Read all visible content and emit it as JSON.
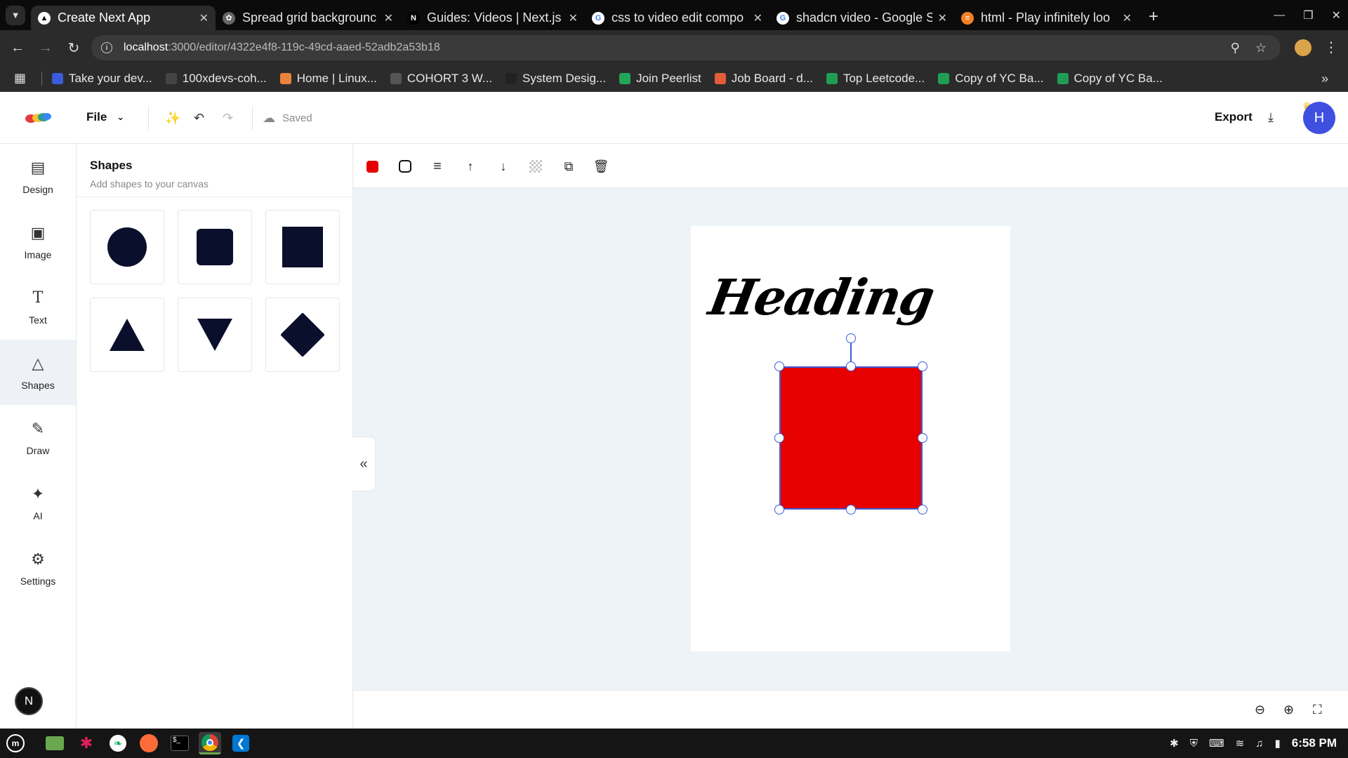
{
  "browser": {
    "tabs": [
      {
        "title": "Create Next App",
        "active": true
      },
      {
        "title": "Spread grid backgrounc",
        "active": false
      },
      {
        "title": "Guides: Videos | Next.js",
        "active": false
      },
      {
        "title": "css to video edit compo",
        "active": false
      },
      {
        "title": "shadcn video - Google S",
        "active": false
      },
      {
        "title": "html - Play infinitely loo",
        "active": false
      }
    ],
    "url_host": "localhost",
    "url_path": ":3000/editor/4322e4f8-119c-49cd-aaed-52adb2a53b18",
    "bookmarks": [
      {
        "label": "Take your dev...",
        "color": "#3b5bdb"
      },
      {
        "label": "100xdevs-coh...",
        "color": "#444444"
      },
      {
        "label": "Home | Linux...",
        "color": "#e8843c"
      },
      {
        "label": "COHORT 3 W...",
        "color": "#555555"
      },
      {
        "label": "System Desig...",
        "color": "#222222"
      },
      {
        "label": "Join Peerlist",
        "color": "#22a559"
      },
      {
        "label": "Job Board - d...",
        "color": "#e35d3a"
      },
      {
        "label": "Top Leetcode...",
        "color": "#1f9d55"
      },
      {
        "label": "Copy of YC Ba...",
        "color": "#1f9d55"
      },
      {
        "label": "Copy of YC Ba...",
        "color": "#1f9d55"
      }
    ]
  },
  "header": {
    "file_label": "File",
    "saved_label": "Saved",
    "export_label": "Export",
    "avatar_initial": "H"
  },
  "rail": {
    "items": [
      {
        "label": "Design",
        "icon": "layout-icon",
        "active": false
      },
      {
        "label": "Image",
        "icon": "image-icon",
        "active": false
      },
      {
        "label": "Text",
        "icon": "text-icon",
        "active": false
      },
      {
        "label": "Shapes",
        "icon": "shapes-icon",
        "active": true
      },
      {
        "label": "Draw",
        "icon": "pencil-icon",
        "active": false
      },
      {
        "label": "AI",
        "icon": "sparkles-icon",
        "active": false
      },
      {
        "label": "Settings",
        "icon": "gear-icon",
        "active": false
      }
    ],
    "dev_badge": "N"
  },
  "panel": {
    "title": "Shapes",
    "subtitle": "Add shapes to your canvas",
    "shapes": [
      "circle",
      "rounded-square",
      "square",
      "triangle",
      "inverted-triangle",
      "diamond"
    ]
  },
  "canvas": {
    "heading_text": "Heading",
    "selected_fill": "#e60000",
    "selection_color": "#3b5bdb",
    "background": "#eef3f8"
  },
  "taskbar": {
    "clock": "6:58 PM"
  },
  "colors": {
    "accent": "#3b5bdb",
    "avatar": "#3f4fe0",
    "shape_fill": "#0a0f2c"
  }
}
